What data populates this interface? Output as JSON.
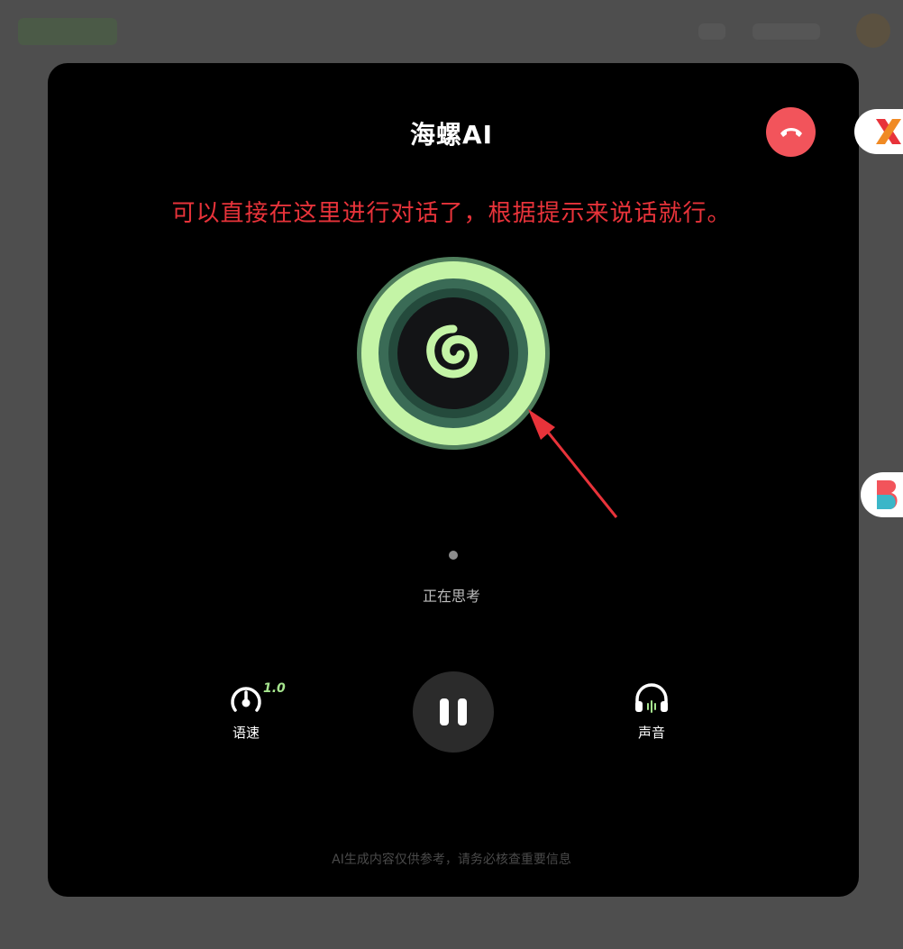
{
  "modal": {
    "title": "海螺AI",
    "annotation": "可以直接在这里进行对话了，根据提示来说话就行。",
    "status_text": "正在思考",
    "disclaimer": "AI生成内容仅供参考，请务必核查重要信息"
  },
  "controls": {
    "speed_label": "语速",
    "speed_value": "1.0",
    "voice_label": "声音"
  },
  "icons": {
    "hangup": "phone-hangup-icon",
    "orb": "hailuo-spiral-logo-icon",
    "speed": "speedometer-icon",
    "pause": "pause-icon",
    "voice": "headphones-icon"
  },
  "colors": {
    "hangup_bg": "#f2545b",
    "annotation": "#e8333a",
    "orb_light": "#c4f4a6",
    "orb_dark": "#2e5c47",
    "speed_value": "#a6e58e"
  }
}
